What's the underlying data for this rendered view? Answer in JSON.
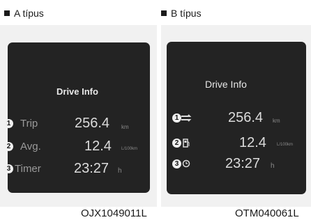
{
  "panel_a": {
    "caption": "A típus",
    "screen_title": "Drive Info",
    "rows": [
      {
        "num": "1",
        "label": "Trip",
        "value": "256.4",
        "unit": "km"
      },
      {
        "num": "2",
        "label": "Avg.",
        "value": "12.4",
        "unit": "L/100km"
      },
      {
        "num": "3",
        "label": "Timer",
        "value": "23:27",
        "unit": "h"
      }
    ],
    "code": "OJX1049011L"
  },
  "panel_b": {
    "caption": "B típus",
    "screen_title": "Drive Info",
    "rows": [
      {
        "num": "1",
        "icon": "trip-distance-icon",
        "value": "256.4",
        "unit": "km"
      },
      {
        "num": "2",
        "icon": "fuel-pump-icon",
        "value": "12.4",
        "unit": "L/100km"
      },
      {
        "num": "3",
        "icon": "clock-icon",
        "value": "23:27",
        "unit": "h"
      }
    ],
    "code": "OTM040061L"
  }
}
